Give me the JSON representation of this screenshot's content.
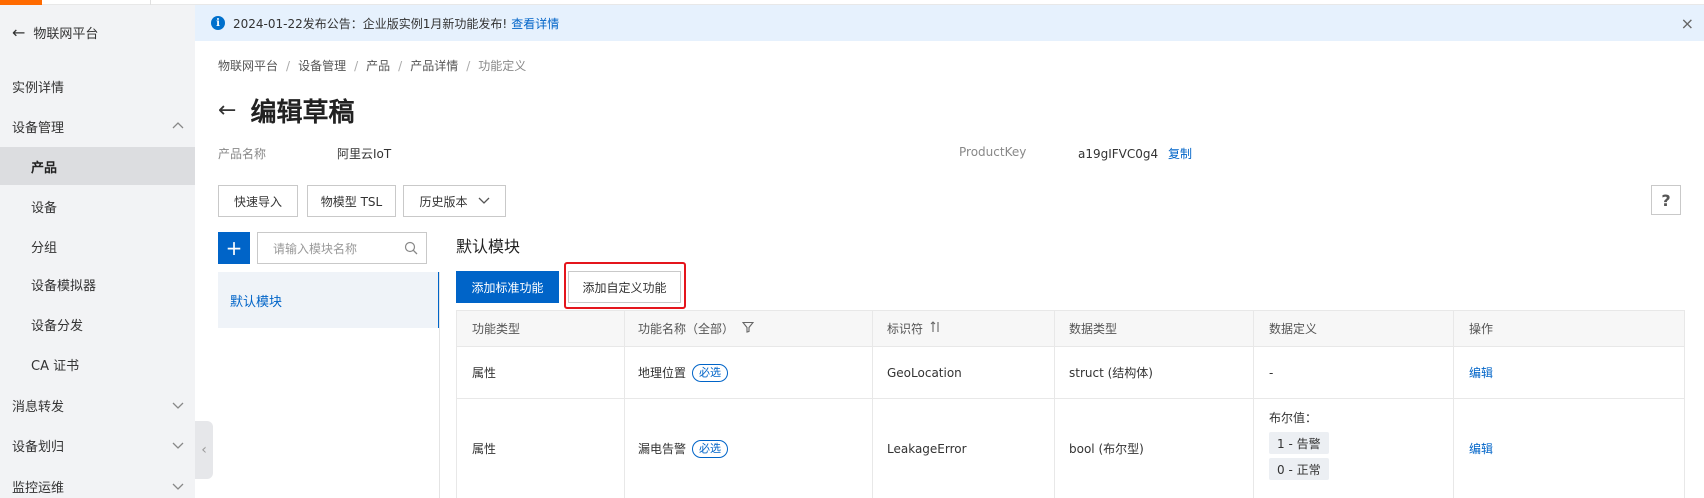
{
  "sidebar": {
    "back_label": "物联网平台",
    "items": [
      {
        "label": "实例详情"
      },
      {
        "label": "设备管理"
      },
      {
        "label": "产品"
      },
      {
        "label": "设备"
      },
      {
        "label": "分组"
      },
      {
        "label": "设备模拟器"
      },
      {
        "label": "设备分发"
      },
      {
        "label": "CA 证书"
      },
      {
        "label": "消息转发"
      },
      {
        "label": "设备划归"
      },
      {
        "label": "监控运维"
      }
    ],
    "collapse_glyph": "‹"
  },
  "announcement": {
    "text": "2024-01-22发布公告：企业版实例1月新功能发布!",
    "link": "查看详情",
    "close": "×"
  },
  "breadcrumb": [
    "物联网平台",
    "设备管理",
    "产品",
    "产品详情",
    "功能定义"
  ],
  "page": {
    "title": "编辑草稿",
    "product_name_key": "产品名称",
    "product_name_value": "阿里云IoT",
    "product_key_key": "ProductKey",
    "product_key_value": "a19gIFVC0g4",
    "copy_label": "复制"
  },
  "toolbar": {
    "quick_import": "快速导入",
    "tsl": "物模型 TSL",
    "history": "历史版本",
    "help": "?"
  },
  "modules": {
    "add_glyph": "+",
    "search_placeholder": "请输入模块名称",
    "items": [
      {
        "label": "默认模块"
      }
    ]
  },
  "main": {
    "module_title": "默认模块",
    "add_standard": "添加标准功能",
    "add_custom": "添加自定义功能"
  },
  "table": {
    "headers": [
      "功能类型",
      "功能名称（全部）",
      "标识符",
      "数据类型",
      "数据定义",
      "操作"
    ],
    "rows": [
      {
        "type": "属性",
        "name": "地理位置",
        "tag": "必选",
        "identifier": "GeoLocation",
        "datatype": "struct (结构体)",
        "definition": "-",
        "action": "编辑"
      },
      {
        "type": "属性",
        "name": "漏电告警",
        "tag": "必选",
        "identifier": "LeakageError",
        "datatype": "bool (布尔型)",
        "definition_label": "布尔值：",
        "definition_values": [
          "1 - 告警",
          "0 - 正常"
        ],
        "action": "编辑"
      }
    ]
  },
  "colors": {
    "primary": "#0064c8",
    "highlight": "#e4151c",
    "brand": "#ff6a00",
    "announce_bg": "#e6f1fd",
    "sidebar_bg": "#f2f3f5"
  }
}
